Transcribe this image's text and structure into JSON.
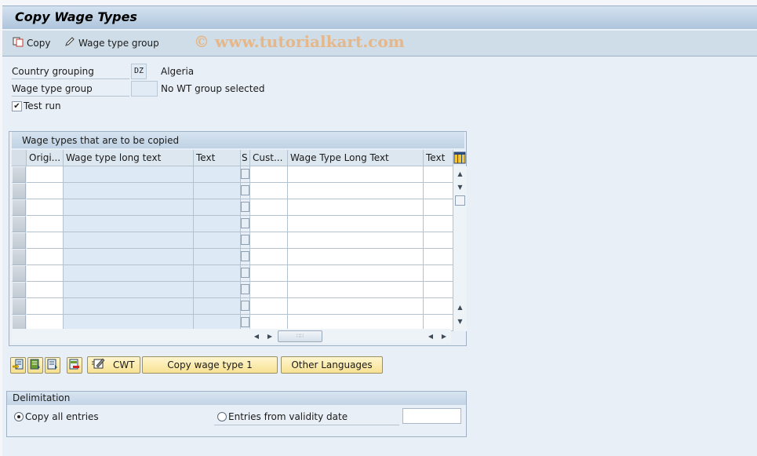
{
  "window": {
    "title": "Copy Wage Types"
  },
  "toolbar": {
    "copy_label": "Copy",
    "wage_type_group_label": "Wage type group",
    "watermark": "© www.tutorialkart.com"
  },
  "form": {
    "country_grouping_label": "Country grouping",
    "country_grouping_value": "DZ",
    "country_grouping_text": "Algeria",
    "wage_type_group_label": "Wage type group",
    "wage_type_group_value": "",
    "wage_type_group_text": "No WT group selected",
    "test_run_label": "Test run",
    "test_run_checked": true
  },
  "table": {
    "title": "Wage types that are to be copied",
    "columns": [
      "Origi...",
      "Wage type long text",
      "Text",
      "S",
      "Cust...",
      "Wage Type Long Text",
      "Text"
    ],
    "visible_rows": 10,
    "rows": []
  },
  "buttons": {
    "icon_buttons": [
      "insert-row-icon",
      "select-all-icon",
      "deselect-all-icon",
      "delete-row-icon"
    ],
    "cwt_label": "CWT",
    "copy_wage_type_label": "Copy wage type 1",
    "other_languages_label": "Other Languages"
  },
  "delimitation": {
    "title": "Delimitation",
    "option_all_label": "Copy all entries",
    "option_date_label": "Entries from validity date",
    "selected": "all",
    "validity_date": ""
  }
}
